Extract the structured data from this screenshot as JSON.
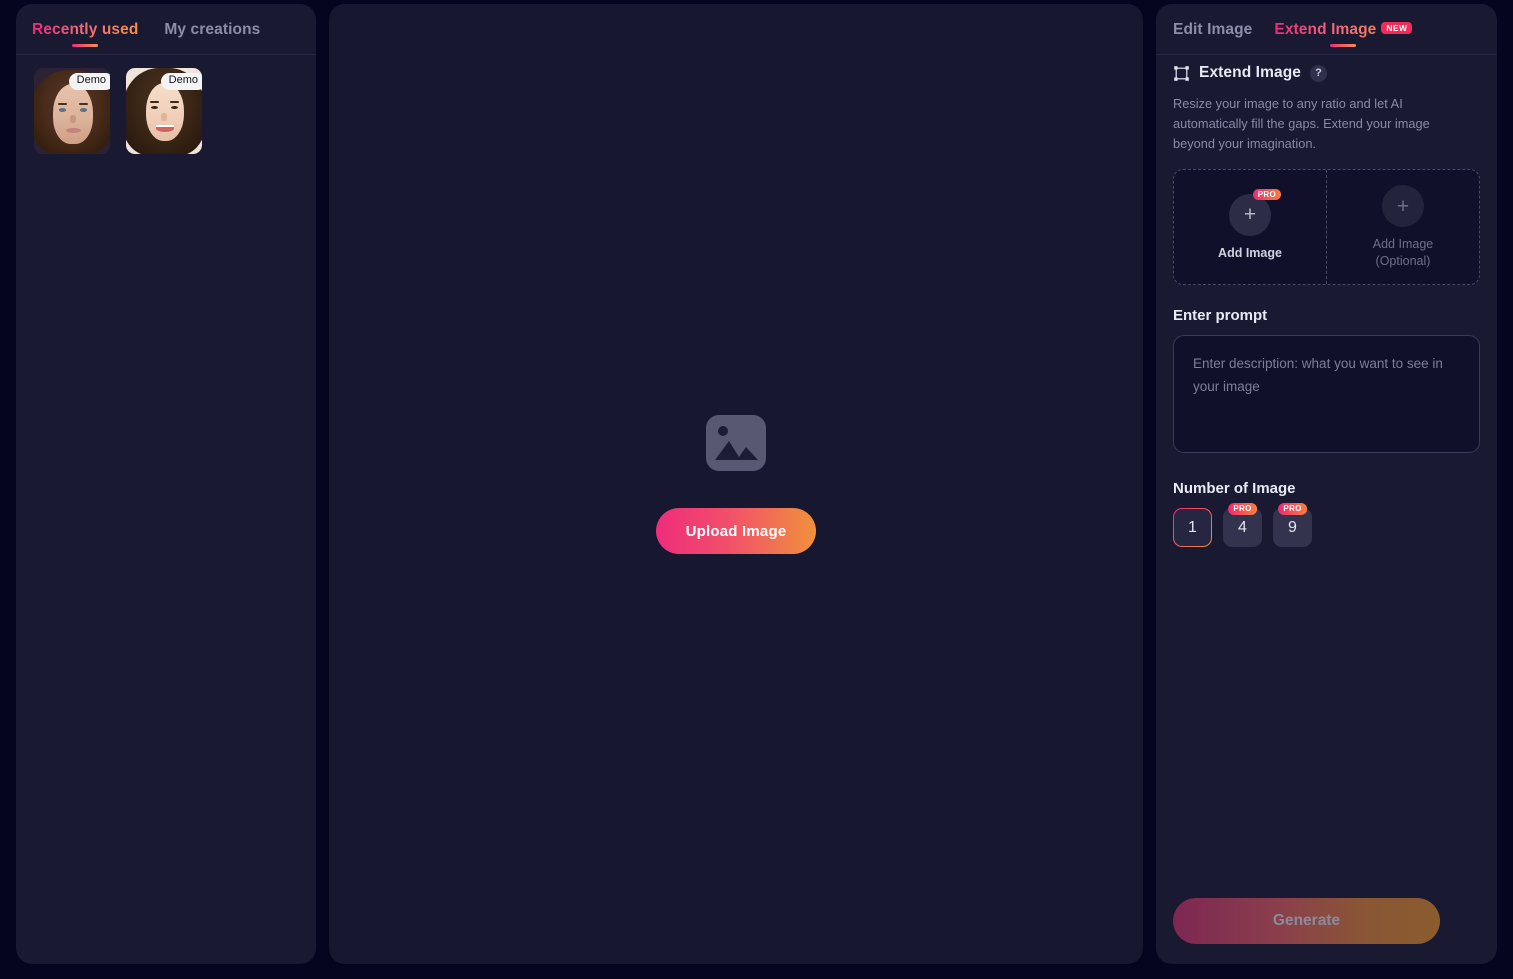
{
  "left_panel": {
    "tabs": [
      {
        "label": "Recently used",
        "active": true
      },
      {
        "label": "My creations",
        "active": false
      }
    ],
    "thumbnails": [
      {
        "badge": "Demo",
        "alt": "woman-portrait-1"
      },
      {
        "badge": "Demo",
        "alt": "woman-portrait-2"
      }
    ]
  },
  "center_panel": {
    "placeholder_icon": "image-placeholder-icon",
    "upload_label": "Upload Image"
  },
  "right_panel": {
    "tabs": [
      {
        "label": "Edit Image",
        "active": false,
        "badge": ""
      },
      {
        "label": "Extend Image",
        "active": true,
        "badge": "NEW"
      }
    ],
    "section": {
      "icon": "crop-frame-icon",
      "title": "Extend Image",
      "help": "?",
      "description": "Resize your image to any ratio and let AI automatically fill the gaps. Extend your image beyond your imagination."
    },
    "add_image": {
      "primary": {
        "label": "Add Image",
        "badge": "PRO",
        "plus": "+"
      },
      "secondary": {
        "label": "Add Image\n(Optional)",
        "label_line1": "Add Image",
        "label_line2": "(Optional)",
        "plus": "+"
      }
    },
    "prompt": {
      "label": "Enter prompt",
      "value": "",
      "placeholder": "Enter description: what you want to see in your image"
    },
    "number_of_image": {
      "label": "Number of Image",
      "options": [
        {
          "value": "1",
          "badge": "",
          "selected": true
        },
        {
          "value": "4",
          "badge": "PRO",
          "selected": false
        },
        {
          "value": "9",
          "badge": "PRO",
          "selected": false
        }
      ]
    },
    "generate_label": "Generate"
  },
  "colors": {
    "page_bg": "#050520",
    "panel_bg": "#191932",
    "center_panel_bg": "#171730",
    "accent_pink": "#ee2d7c",
    "accent_orange": "#f0913c",
    "new_badge": "#f32b5a",
    "muted_text": "#8a8aa5"
  }
}
